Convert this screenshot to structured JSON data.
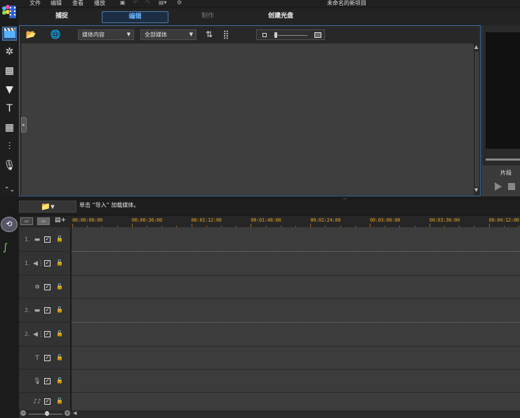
{
  "menu": {
    "items": [
      "文件",
      "编辑",
      "查看",
      "播放"
    ],
    "window_title": "未命名的新项目"
  },
  "mode_tabs": [
    {
      "label": "捕捉",
      "state": "normal"
    },
    {
      "label": "编辑",
      "state": "active"
    },
    {
      "label": "制作",
      "state": "disabled"
    },
    {
      "label": "创建光盘",
      "state": "normal"
    }
  ],
  "library": {
    "content_filter": "媒体内容",
    "media_filter": "全部媒体"
  },
  "preview": {
    "label": "片段"
  },
  "timeline": {
    "hint": "单击 “导入” 加载媒体。",
    "ruler_ticks": [
      "00:00:00:00",
      "00:00:36:00",
      "00:01:12:00",
      "00:01:48:00",
      "00:02:24:00",
      "00:03:00:00",
      "00:03:36:00",
      "00:04:12:00"
    ],
    "tracks": [
      {
        "num": "1.",
        "icon": "video-track-icon"
      },
      {
        "num": "1.",
        "icon": "audio-track-icon"
      },
      {
        "num": "",
        "icon": "effects-track-icon"
      },
      {
        "num": "2.",
        "icon": "video-track-icon"
      },
      {
        "num": "2.",
        "icon": "audio-track-icon"
      },
      {
        "num": "",
        "icon": "title-track-icon"
      },
      {
        "num": "",
        "icon": "voice-track-icon"
      },
      {
        "num": "",
        "icon": "music-track-icon"
      }
    ]
  },
  "colors": {
    "accent_blue": "#66b3ff",
    "ruler_text": "#e0a020"
  }
}
